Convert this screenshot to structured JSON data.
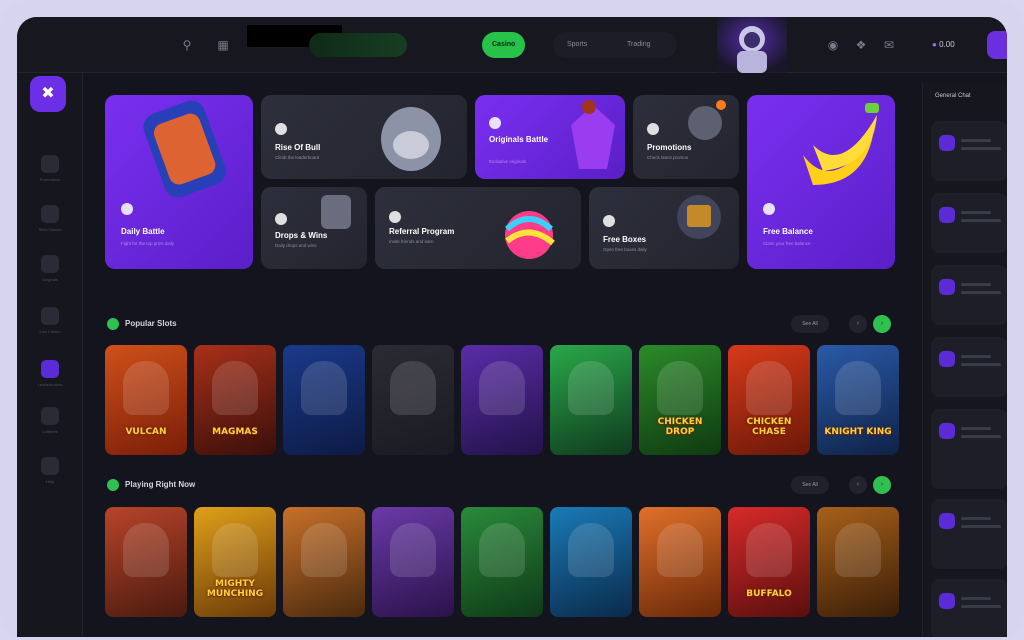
{
  "topbar": {
    "nav": [
      "Casino",
      "Sports",
      "Trading"
    ],
    "balance": "0.00"
  },
  "sidebar": {
    "items": [
      "Promotions",
      "Slots Games",
      "Originals",
      "Live Casino",
      "Leaderboards",
      "Lotteries",
      "Help"
    ]
  },
  "promos": {
    "daily_battle": {
      "title": "Daily Battle",
      "subtitle": "Fight for the top prize daily"
    },
    "rise_of_the_bull": {
      "title": "Rise Of Bull",
      "subtitle": "Climb the leaderboard"
    },
    "originals": {
      "title": "Originals Battle",
      "subtitle": "Exclusive originals"
    },
    "promotions": {
      "title": "Promotions",
      "subtitle": "Check latest promos"
    },
    "drops": {
      "title": "Drops & Wins",
      "subtitle": "Daily drops and wins"
    },
    "referral": {
      "title": "Referral Program",
      "subtitle": "Invite friends and earn"
    },
    "free_boxes": {
      "title": "Free Boxes",
      "subtitle": "Open free boxes daily"
    },
    "free_balance": {
      "title": "Free Balance",
      "subtitle": "Claim your free balance"
    }
  },
  "popular": {
    "title": "Popular Slots",
    "see_all": "See All",
    "games": [
      "VULCAN",
      "MAGMAS",
      "",
      "",
      "",
      "",
      "CHICKEN DROP",
      "CHICKEN CHASE",
      "KNIGHT KING"
    ]
  },
  "playing": {
    "title": "Playing Right Now",
    "see_all": "See All",
    "games": [
      "",
      "MIGHTY MUNCHING",
      "",
      "",
      "",
      "",
      "",
      "BUFFALO",
      ""
    ]
  },
  "chat": {
    "title": "General Chat"
  },
  "colors": {
    "accent": "#6b2fe0",
    "green": "#2fc04f",
    "bg": "#13141d"
  }
}
